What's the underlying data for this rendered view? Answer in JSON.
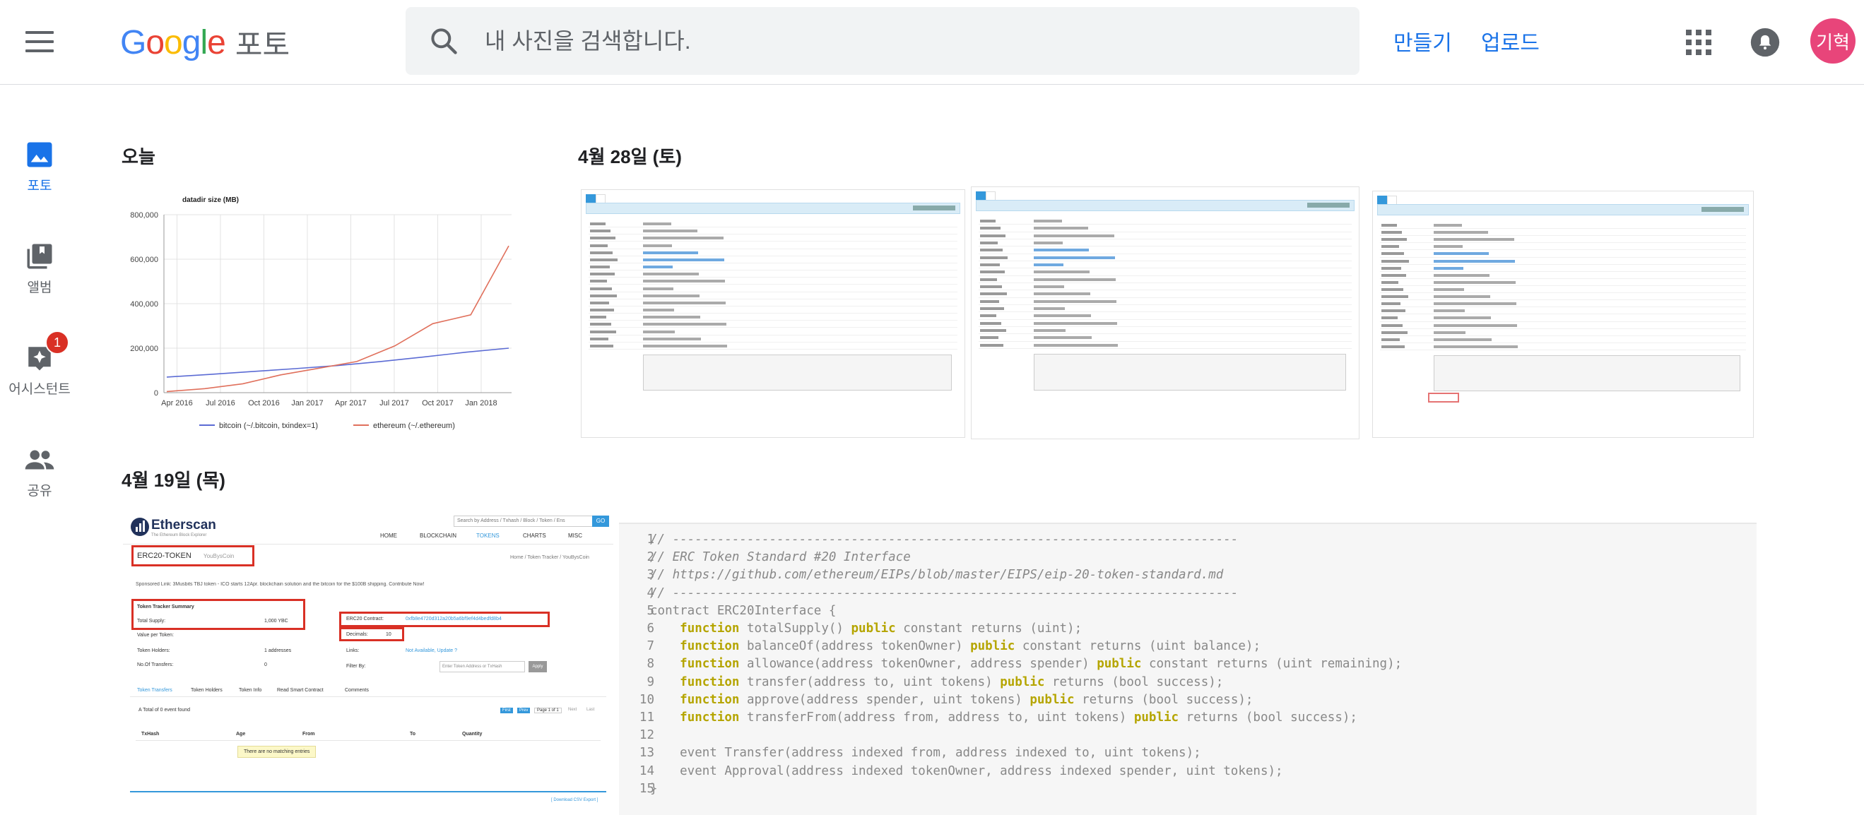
{
  "header": {
    "logo_word": "Google",
    "product": "포토",
    "search_placeholder": "내 사진을 검색합니다.",
    "create_label": "만들기",
    "upload_label": "업로드",
    "avatar_text": "기혁"
  },
  "sidebar": {
    "items": [
      {
        "label": "포토",
        "icon": "photo-icon",
        "active": true
      },
      {
        "label": "앨범",
        "icon": "album-icon"
      },
      {
        "label": "어시스턴트",
        "icon": "assistant-icon",
        "badge": "1"
      },
      {
        "label": "공유",
        "icon": "people-icon"
      }
    ]
  },
  "sections": [
    {
      "date": "오늘"
    },
    {
      "date": "4월 28일 (토)"
    },
    {
      "date": "4월 19일 (목)"
    }
  ],
  "chart_data": {
    "type": "line",
    "title": "datadir size (MB)",
    "x": [
      "Apr 2016",
      "Jul 2016",
      "Oct 2016",
      "Jan 2017",
      "Apr 2017",
      "Jul 2017",
      "Oct 2017",
      "Jan 2018"
    ],
    "yticks": [
      "0",
      "200,000",
      "400,000",
      "600,000",
      "800,000"
    ],
    "ylim": [
      0,
      800000
    ],
    "grid": true,
    "legend": "bottom",
    "series": [
      {
        "name": "bitcoin (~/.bitcoin, txindex=1)",
        "color": "#5b6bd4",
        "values": [
          70000,
          82000,
          95000,
          108000,
          122000,
          140000,
          160000,
          182000,
          200000
        ]
      },
      {
        "name": "ethereum (~/.ethereum)",
        "color": "#e0705c",
        "values": [
          5000,
          18000,
          40000,
          80000,
          110000,
          140000,
          210000,
          310000,
          350000,
          660000
        ]
      }
    ]
  },
  "etherscan": {
    "logo": "Etherscan",
    "tagline": "The Ethereum Block Explorer",
    "search_placeholder": "Search by Address / Txhash / Block / Token / Ens",
    "go": "GO",
    "nav": [
      "HOME",
      "BLOCKCHAIN",
      "TOKENS",
      "CHARTS",
      "MISC"
    ],
    "page_title": "ERC20-TOKEN",
    "page_sub": "YouBysCoin",
    "breadcrumb": "Home / Token Tracker / YouBysCoin",
    "sponsored": "Sponsored Link: 3Musbits TBJ token - ICO starts 12Apr. blockchain solution and the bitcoin for the $100B shipping. Contribute Now!",
    "summary_title": "Token Tracker Summary",
    "total_supply_label": "Total Supply:",
    "total_supply_value": "1,000 YBC",
    "value_per_token": "Value per Token:",
    "token_holders": "Token Holders:",
    "token_holders_value": "1 addresses",
    "no_transfers": "No.Of Transfers:",
    "no_transfers_value": "0",
    "contract_label": "ERC20 Contract:",
    "contract_value": "0xfb8e4720d312a20b5a6bf9ef4d4bedfd8b4",
    "decimals_label": "Decimals:",
    "decimals_value": "10",
    "links_label": "Links:",
    "links_value": "Not Available, Update ?",
    "filter_label": "Filter By:",
    "filter_placeholder": "Enter Token Address or TxHash",
    "apply": "Apply",
    "tabs": [
      "Token Transfers",
      "Token Holders",
      "Token Info",
      "Read Smart Contract",
      "Comments"
    ],
    "events_text": "A Total of 0 event found",
    "pager": [
      "First",
      "Prev",
      "Page 1 of 1",
      "Next",
      "Last"
    ],
    "cols": [
      "TxHash",
      "Age",
      "From",
      "To",
      "Quantity"
    ],
    "no_entries": "There are no matching entries",
    "download": "[ Download CSV Export ]"
  },
  "code": {
    "lines": [
      "// ----------------------------------------------------------------------------",
      "// ERC Token Standard #20 Interface",
      "// https://github.com/ethereum/EIPs/blob/master/EIPS/eip-20-token-standard.md",
      "// ----------------------------------------------------------------------------",
      "contract ERC20Interface {",
      "    function totalSupply() public constant returns (uint);",
      "    function balanceOf(address tokenOwner) public constant returns (uint balance);",
      "    function allowance(address tokenOwner, address spender) public constant returns (uint remaining);",
      "    function transfer(address to, uint tokens) public returns (bool success);",
      "    function approve(address spender, uint tokens) public returns (bool success);",
      "    function transferFrom(address from, address to, uint tokens) public returns (bool success);",
      "",
      "    event Transfer(address indexed from, address indexed to, uint tokens);",
      "    event Approval(address indexed tokenOwner, address indexed spender, uint tokens);",
      "}"
    ]
  }
}
